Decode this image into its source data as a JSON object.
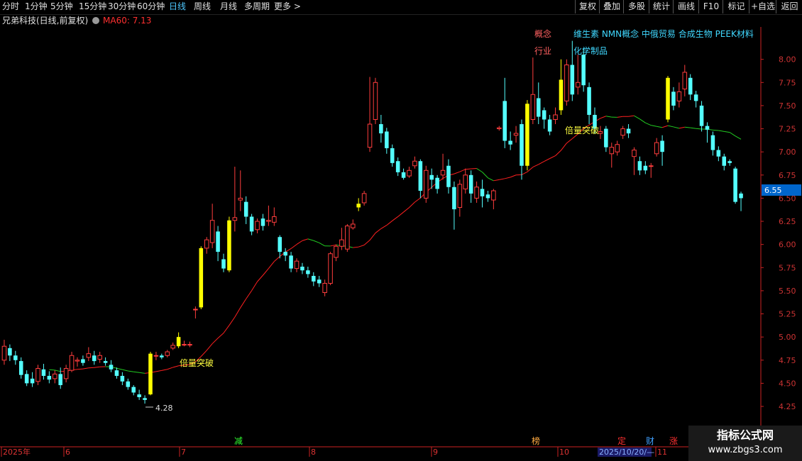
{
  "toolbar": {
    "left": [
      "分时",
      "1分钟",
      "5分钟",
      "15分钟",
      "30分钟",
      "60分钟",
      "日线",
      "周线",
      "月线",
      "多周期",
      "更多 >"
    ],
    "right": [
      "复权",
      "叠加",
      "多股",
      "统计",
      "画线",
      "F10",
      "标记",
      "+自选",
      "返回"
    ]
  },
  "info": {
    "title": "兄弟科技(日线,前复权)",
    "ma_label": "MA60: 7.13"
  },
  "tags": {
    "concept_label": "概念",
    "concept_value": "维生素 NMN概念 中俄贸易 合成生物 PEEK材料",
    "industry_label": "行业",
    "industry_value": "化学制品",
    "breakout1": "倍量突破",
    "breakout2": "倍量突破",
    "low_label": "4.28",
    "price_tag": "6.55"
  },
  "xaxis": {
    "labels": [
      "2025年",
      "6",
      "7",
      "8",
      "9",
      "10",
      "11"
    ],
    "markers": [
      "减",
      "榜",
      "定",
      "财",
      "涨"
    ],
    "date_box": "2025/10/20/—"
  },
  "watermark": {
    "line1": "指标公式网",
    "line2": "www.zbgs3.com"
  },
  "colors": {
    "up": "#ff3d3d",
    "down": "#54ffff",
    "volume_breakout": "#ffff00",
    "ma60": "#ff2020",
    "ma_green": "#22cc22",
    "axis": "#cc2222"
  },
  "chart_data": {
    "type": "candlestick",
    "ylim": [
      4.12,
      8.35
    ],
    "yticks": [
      4.25,
      4.5,
      4.75,
      5.0,
      5.25,
      5.5,
      5.75,
      6.0,
      6.25,
      6.5,
      6.75,
      7.0,
      7.25,
      7.5,
      7.75,
      8.0
    ],
    "ma_label": "MA60: 7.13",
    "candles": [
      {
        "o": 4.75,
        "c": 4.9,
        "h": 4.97,
        "l": 4.7
      },
      {
        "o": 4.88,
        "c": 4.8,
        "h": 4.92,
        "l": 4.74
      },
      {
        "o": 4.8,
        "c": 4.75,
        "h": 4.85,
        "l": 4.7
      },
      {
        "o": 4.74,
        "c": 4.59,
        "h": 4.78,
        "l": 4.55
      },
      {
        "o": 4.6,
        "c": 4.5,
        "h": 4.64,
        "l": 4.47
      },
      {
        "o": 4.55,
        "c": 4.5,
        "h": 4.62,
        "l": 4.46
      },
      {
        "o": 4.52,
        "c": 4.66,
        "h": 4.7,
        "l": 4.48
      },
      {
        "o": 4.65,
        "c": 4.58,
        "h": 4.71,
        "l": 4.54
      },
      {
        "o": 4.58,
        "c": 4.54,
        "h": 4.63,
        "l": 4.5
      },
      {
        "o": 4.55,
        "c": 4.6,
        "h": 4.64,
        "l": 4.5
      },
      {
        "o": 4.6,
        "c": 4.48,
        "h": 4.67,
        "l": 4.44
      },
      {
        "o": 4.55,
        "c": 4.66,
        "h": 4.7,
        "l": 4.51
      },
      {
        "o": 4.64,
        "c": 4.8,
        "h": 4.84,
        "l": 4.62
      },
      {
        "o": 4.74,
        "c": 4.75,
        "h": 4.78,
        "l": 4.68
      },
      {
        "o": 4.76,
        "c": 4.72,
        "h": 4.8,
        "l": 4.69
      },
      {
        "o": 4.78,
        "c": 4.82,
        "h": 4.89,
        "l": 4.74
      },
      {
        "o": 4.8,
        "c": 4.74,
        "h": 4.85,
        "l": 4.7
      },
      {
        "o": 4.76,
        "c": 4.8,
        "h": 4.84,
        "l": 4.72
      },
      {
        "o": 4.74,
        "c": 4.72,
        "h": 4.78,
        "l": 4.69
      },
      {
        "o": 4.7,
        "c": 4.65,
        "h": 4.75,
        "l": 4.62
      },
      {
        "o": 4.64,
        "c": 4.58,
        "h": 4.67,
        "l": 4.55
      },
      {
        "o": 4.58,
        "c": 4.52,
        "h": 4.62,
        "l": 4.48
      },
      {
        "o": 4.52,
        "c": 4.46,
        "h": 4.55,
        "l": 4.43
      },
      {
        "o": 4.46,
        "c": 4.4,
        "h": 4.48,
        "l": 4.37
      },
      {
        "o": 4.38,
        "c": 4.35,
        "h": 4.43,
        "l": 4.32
      },
      {
        "o": 4.34,
        "c": 4.32,
        "h": 4.37,
        "l": 4.28
      },
      {
        "o": 4.38,
        "c": 4.82,
        "h": 4.84,
        "l": 4.37,
        "breakout": true
      },
      {
        "o": 4.8,
        "c": 4.8,
        "h": 4.84,
        "l": 4.75
      },
      {
        "o": 4.8,
        "c": 4.78,
        "h": 4.82,
        "l": 4.76
      },
      {
        "o": 4.8,
        "c": 4.84,
        "h": 4.86,
        "l": 4.78
      },
      {
        "o": 4.88,
        "c": 4.91,
        "h": 4.94,
        "l": 4.86
      },
      {
        "o": 4.9,
        "c": 5.0,
        "h": 5.05,
        "l": 4.88,
        "breakout": true
      },
      {
        "o": 4.92,
        "c": 4.92,
        "h": 4.96,
        "l": 4.9
      },
      {
        "o": 4.92,
        "c": 4.92,
        "h": 4.95,
        "l": 4.89
      },
      {
        "o": 5.3,
        "c": 5.3,
        "h": 5.33,
        "l": 5.2
      },
      {
        "o": 5.32,
        "c": 5.96,
        "h": 5.98,
        "l": 5.3,
        "breakout": true
      },
      {
        "o": 5.96,
        "c": 6.05,
        "h": 6.08,
        "l": 5.9
      },
      {
        "o": 6.02,
        "c": 6.26,
        "h": 6.44,
        "l": 5.96
      },
      {
        "o": 6.14,
        "c": 5.92,
        "h": 6.2,
        "l": 5.82
      },
      {
        "o": 5.84,
        "c": 5.74,
        "h": 5.9,
        "l": 5.7
      },
      {
        "o": 5.72,
        "c": 6.26,
        "h": 6.3,
        "l": 5.7,
        "breakout": true
      },
      {
        "o": 6.26,
        "c": 6.29,
        "h": 6.84,
        "l": 6.14
      },
      {
        "o": 6.48,
        "c": 6.5,
        "h": 6.8,
        "l": 6.36
      },
      {
        "o": 6.46,
        "c": 6.3,
        "h": 6.52,
        "l": 6.22
      },
      {
        "o": 6.3,
        "c": 6.14,
        "h": 6.33,
        "l": 6.1
      },
      {
        "o": 6.16,
        "c": 6.25,
        "h": 6.28,
        "l": 6.12
      },
      {
        "o": 6.28,
        "c": 6.2,
        "h": 6.33,
        "l": 6.15
      },
      {
        "o": 6.25,
        "c": 6.26,
        "h": 6.42,
        "l": 6.2
      },
      {
        "o": 6.24,
        "c": 6.3,
        "h": 6.4,
        "l": 6.2
      },
      {
        "o": 6.08,
        "c": 5.92,
        "h": 6.1,
        "l": 5.85
      },
      {
        "o": 5.92,
        "c": 5.88,
        "h": 5.96,
        "l": 5.82
      },
      {
        "o": 5.88,
        "c": 5.74,
        "h": 5.92,
        "l": 5.7
      },
      {
        "o": 5.74,
        "c": 5.82,
        "h": 5.85,
        "l": 5.7
      },
      {
        "o": 5.76,
        "c": 5.72,
        "h": 5.8,
        "l": 5.68
      },
      {
        "o": 5.72,
        "c": 5.68,
        "h": 5.76,
        "l": 5.64
      },
      {
        "o": 5.66,
        "c": 5.6,
        "h": 5.7,
        "l": 5.55
      },
      {
        "o": 5.62,
        "c": 5.58,
        "h": 5.66,
        "l": 5.54
      },
      {
        "o": 5.48,
        "c": 5.58,
        "h": 5.62,
        "l": 5.44
      },
      {
        "o": 5.58,
        "c": 5.9,
        "h": 5.92,
        "l": 5.56
      },
      {
        "o": 5.86,
        "c": 5.98,
        "h": 6.0,
        "l": 5.82
      },
      {
        "o": 5.98,
        "c": 6.05,
        "h": 6.18,
        "l": 5.94
      },
      {
        "o": 5.95,
        "c": 6.2,
        "h": 6.22,
        "l": 5.92
      },
      {
        "o": 6.18,
        "c": 6.22,
        "h": 6.27,
        "l": 6.16
      },
      {
        "o": 6.4,
        "c": 6.44,
        "h": 6.5,
        "l": 6.36,
        "breakout": true
      },
      {
        "o": 6.45,
        "c": 6.55,
        "h": 6.58,
        "l": 6.42
      },
      {
        "o": 7.05,
        "c": 7.3,
        "h": 7.81,
        "l": 7.0
      },
      {
        "o": 7.35,
        "c": 7.75,
        "h": 7.8,
        "l": 7.3
      },
      {
        "o": 7.3,
        "c": 7.2,
        "h": 7.4,
        "l": 7.1
      },
      {
        "o": 7.22,
        "c": 7.04,
        "h": 7.26,
        "l": 6.98
      },
      {
        "o": 7.04,
        "c": 6.88,
        "h": 7.08,
        "l": 6.84
      },
      {
        "o": 6.9,
        "c": 6.78,
        "h": 6.94,
        "l": 6.74
      },
      {
        "o": 6.78,
        "c": 6.72,
        "h": 6.82,
        "l": 6.7
      },
      {
        "o": 6.74,
        "c": 6.8,
        "h": 6.84,
        "l": 6.72
      },
      {
        "o": 6.85,
        "c": 6.9,
        "h": 6.95,
        "l": 6.82
      },
      {
        "o": 6.9,
        "c": 6.58,
        "h": 6.92,
        "l": 6.5
      },
      {
        "o": 6.5,
        "c": 6.8,
        "h": 6.85,
        "l": 6.45
      },
      {
        "o": 6.75,
        "c": 6.7,
        "h": 6.82,
        "l": 6.6
      },
      {
        "o": 6.72,
        "c": 6.6,
        "h": 6.75,
        "l": 6.55
      },
      {
        "o": 6.75,
        "c": 6.8,
        "h": 6.98,
        "l": 6.7
      },
      {
        "o": 6.85,
        "c": 6.62,
        "h": 6.92,
        "l": 6.55
      },
      {
        "o": 6.62,
        "c": 6.38,
        "h": 6.68,
        "l": 6.16
      },
      {
        "o": 6.4,
        "c": 6.65,
        "h": 6.7,
        "l": 6.3
      },
      {
        "o": 6.6,
        "c": 6.75,
        "h": 6.82,
        "l": 6.55
      },
      {
        "o": 6.75,
        "c": 6.55,
        "h": 6.8,
        "l": 6.45
      },
      {
        "o": 6.5,
        "c": 6.62,
        "h": 6.68,
        "l": 6.45
      },
      {
        "o": 6.6,
        "c": 6.52,
        "h": 6.7,
        "l": 6.4
      },
      {
        "o": 6.54,
        "c": 6.5,
        "h": 6.58,
        "l": 6.46
      },
      {
        "o": 6.48,
        "c": 6.58,
        "h": 6.6,
        "l": 6.38
      },
      {
        "o": 7.25,
        "c": 7.26,
        "h": 7.28,
        "l": 7.23
      },
      {
        "o": 7.55,
        "c": 7.12,
        "h": 7.8,
        "l": 7.04
      },
      {
        "o": 7.12,
        "c": 7.08,
        "h": 7.22,
        "l": 7.02
      },
      {
        "o": 7.18,
        "c": 7.2,
        "h": 7.28,
        "l": 7.1
      },
      {
        "o": 7.3,
        "c": 6.85,
        "h": 7.35,
        "l": 6.7
      },
      {
        "o": 6.85,
        "c": 7.52,
        "h": 7.56,
        "l": 6.8,
        "breakout": true
      },
      {
        "o": 7.35,
        "c": 7.62,
        "h": 8.02,
        "l": 7.3
      },
      {
        "o": 7.58,
        "c": 7.38,
        "h": 7.75,
        "l": 7.3
      },
      {
        "o": 7.45,
        "c": 7.35,
        "h": 7.48,
        "l": 7.25
      },
      {
        "o": 7.35,
        "c": 7.22,
        "h": 7.4,
        "l": 7.18
      },
      {
        "o": 7.35,
        "c": 7.4,
        "h": 7.48,
        "l": 7.3
      },
      {
        "o": 7.45,
        "c": 7.78,
        "h": 8.0,
        "l": 7.4,
        "breakout": true
      },
      {
        "o": 7.55,
        "c": 7.94,
        "h": 8.0,
        "l": 7.5
      },
      {
        "o": 7.94,
        "c": 7.62,
        "h": 8.2,
        "l": 7.55
      },
      {
        "o": 7.7,
        "c": 7.75,
        "h": 8.05,
        "l": 7.62
      },
      {
        "o": 8.05,
        "c": 7.72,
        "h": 8.12,
        "l": 7.65
      },
      {
        "o": 7.7,
        "c": 7.4,
        "h": 7.75,
        "l": 7.3
      },
      {
        "o": 7.4,
        "c": 7.25,
        "h": 7.48,
        "l": 7.2
      },
      {
        "o": 7.2,
        "c": 7.22,
        "h": 7.28,
        "l": 7.14
      },
      {
        "o": 7.25,
        "c": 7.05,
        "h": 7.28,
        "l": 7.0
      },
      {
        "o": 6.98,
        "c": 7.05,
        "h": 7.1,
        "l": 6.83
      },
      {
        "o": 7.0,
        "c": 7.08,
        "h": 7.12,
        "l": 6.96
      },
      {
        "o": 7.18,
        "c": 7.25,
        "h": 7.28,
        "l": 7.14
      },
      {
        "o": 7.25,
        "c": 7.2,
        "h": 7.3,
        "l": 7.15
      },
      {
        "o": 6.95,
        "c": 7.02,
        "h": 7.05,
        "l": 6.75
      },
      {
        "o": 6.9,
        "c": 6.8,
        "h": 6.95,
        "l": 6.75
      },
      {
        "o": 6.85,
        "c": 6.8,
        "h": 6.9,
        "l": 6.76
      },
      {
        "o": 6.85,
        "c": 6.85,
        "h": 6.88,
        "l": 6.72
      },
      {
        "o": 6.98,
        "c": 7.1,
        "h": 7.15,
        "l": 6.95
      },
      {
        "o": 7.12,
        "c": 7.0,
        "h": 7.18,
        "l": 6.85
      },
      {
        "o": 7.35,
        "c": 7.8,
        "h": 7.82,
        "l": 7.32,
        "breakout": true
      },
      {
        "o": 7.65,
        "c": 7.5,
        "h": 7.7,
        "l": 7.45
      },
      {
        "o": 7.55,
        "c": 7.65,
        "h": 7.75,
        "l": 7.48
      },
      {
        "o": 7.68,
        "c": 7.86,
        "h": 7.94,
        "l": 7.6
      },
      {
        "o": 7.8,
        "c": 7.62,
        "h": 7.84,
        "l": 7.56
      },
      {
        "o": 7.62,
        "c": 7.55,
        "h": 7.66,
        "l": 7.48
      },
      {
        "o": 7.5,
        "c": 7.28,
        "h": 7.55,
        "l": 7.22
      },
      {
        "o": 7.28,
        "c": 7.24,
        "h": 7.32,
        "l": 7.1
      },
      {
        "o": 7.18,
        "c": 7.02,
        "h": 7.22,
        "l": 6.96
      },
      {
        "o": 7.02,
        "c": 6.95,
        "h": 7.06,
        "l": 6.9
      },
      {
        "o": 6.95,
        "c": 6.85,
        "h": 6.98,
        "l": 6.8
      },
      {
        "o": 6.9,
        "c": 6.88,
        "h": 6.92,
        "l": 6.85
      },
      {
        "o": 6.82,
        "c": 6.46,
        "h": 6.84,
        "l": 6.44
      },
      {
        "o": 6.55,
        "c": 6.5,
        "h": 6.57,
        "l": 6.36
      }
    ]
  }
}
